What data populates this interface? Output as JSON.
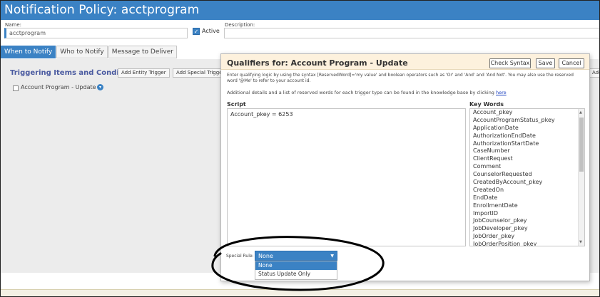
{
  "header": {
    "title": "Notification Policy: acctprogram"
  },
  "form": {
    "name_label": "Name:",
    "name_value": "acctprogram",
    "active_label": "Active",
    "active_checked": true,
    "description_label": "Description:",
    "description_value": ""
  },
  "tabs": [
    {
      "label": "When to Notify",
      "active": true
    },
    {
      "label": "Who to Notify",
      "active": false
    },
    {
      "label": "Message to Deliver",
      "active": false
    }
  ],
  "triggering": {
    "title": "Triggering Items and Conditions",
    "add_entity_label": "Add Entity Trigger",
    "add_special_label": "Add Special Trigger",
    "right_button_label": "Add",
    "item_label": "Account Program - Update"
  },
  "modal": {
    "title": "Qualifiers for: Account Program - Update",
    "check_syntax_label": "Check Syntax",
    "save_label": "Save",
    "cancel_label": "Cancel",
    "instructions": "Enter qualifying logic by using the syntax [ReservedWord]='my value' and boolean operators such as 'Or' and 'And' and 'And Not'. You may also use the reserved word '@Me' to refer to your account id.",
    "additional_text": "Additional details and a list of reserved words for each trigger type can be found in the knowledge base by clicking",
    "additional_link": "here",
    "script_label": "Script",
    "script_value": "Account_pkey = 6253",
    "keywords_label": "Key Words",
    "keywords": [
      "Account_pkey",
      "AccountProgramStatus_pkey",
      "ApplicationDate",
      "AuthorizationEndDate",
      "AuthorizationStartDate",
      "CaseNumber",
      "ClientRequest",
      "Comment",
      "CounselorRequested",
      "CreatedByAccount_pkey",
      "CreatedOn",
      "EndDate",
      "EnrollmentDate",
      "ImportID",
      "JobCounselor_pkey",
      "JobDeveloper_pkey",
      "JobOrder_pkey",
      "JobOrderPosition_pkey"
    ],
    "special_rule_label": "Special Rule:",
    "special_rule_selected": "None",
    "special_rule_options": [
      "None",
      "Status Update Only"
    ]
  },
  "colors": {
    "accent": "#3b82c4",
    "modal_header": "#fdf1dd",
    "page_bg": "#ececec",
    "title_text": "#4a5aa0"
  },
  "icons": {
    "info": "info-circle-icon",
    "check": "check-icon",
    "dropdown": "chevron-down-icon"
  }
}
